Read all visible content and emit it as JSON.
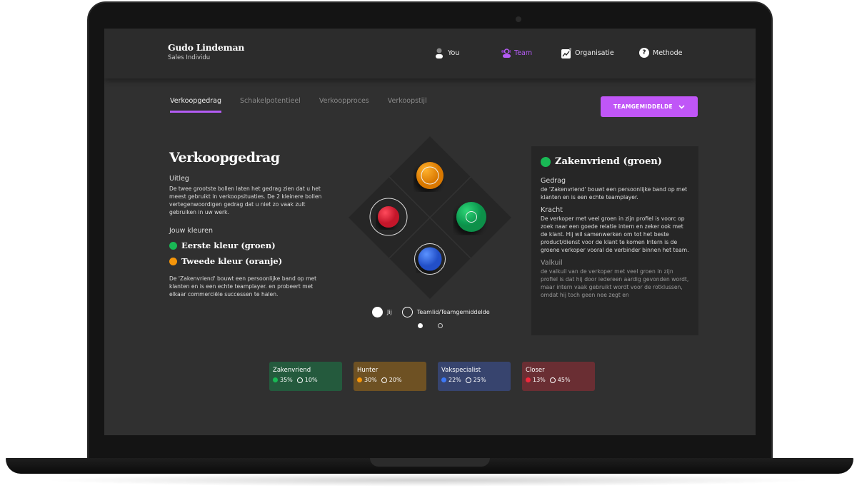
{
  "header": {
    "user_name": "Gudo Lindeman",
    "user_role": "Sales Individu",
    "nav": [
      {
        "label": "You",
        "icon": "user-icon"
      },
      {
        "label": "Team",
        "icon": "team-icon",
        "active": true
      },
      {
        "label": "Organisatie",
        "icon": "chart-icon"
      },
      {
        "label": "Methode",
        "icon": "question-icon"
      }
    ]
  },
  "tabs": [
    {
      "label": "Verkoopgedrag",
      "active": true
    },
    {
      "label": "Schakelpotentieel"
    },
    {
      "label": "Verkoopproces"
    },
    {
      "label": "Verkoopstijl"
    }
  ],
  "dropdown": {
    "label": "TEAMGEMIDDELDE"
  },
  "accent": "#c056f7",
  "main": {
    "title": "Verkoopgedrag",
    "uitleg_label": "Uitleg",
    "uitleg_text": "De twee grootste bollen laten het gedrag zien dat u het meest gebruikt in verkoopsituaties. De 2 kleinere bollen vertegenwoordigen gedrag dat u niet zo vaak zult gebruiken in uw werk.",
    "colors_label": "Jouw kleuren",
    "first_color": "Eerste kleur (groen)",
    "second_color": "Tweede kleur (oranje)",
    "description": "De 'Zakenvriend' bouwt een persoonlijke band op met klanten en is een echte teamplayer. en probeert met elkaar commerciële successen te halen."
  },
  "legend": {
    "you": "Jij",
    "team": "Teamlid/Teamgemiddelde"
  },
  "pagination": {
    "current": 1,
    "total": 2
  },
  "panel": {
    "title": "Zakenvriend (groen)",
    "gedrag_label": "Gedrag",
    "gedrag_text": "de 'Zakenvriend' bouwt een persoonlijke band op met klanten en is een echte teamplayer.",
    "kracht_label": "Kracht",
    "kracht_text": "De verkoper met veel groen in zijn profiel is voorc op zoek naar een goede relatie intern en zeker ook met de klant. Hij wil samenwerken om tot het beste product/dienst voor de klant te komen Intern is de groene verkoper vooral de verbinder binnen het team.",
    "valkuil_label": "Valkuil",
    "valkuil_text": "de valkuil van de verkoper met veel groen in zijn profiel is dat hij door iedereen aardig gevonden wordt, maar intern vaak gebruikt wordt voor de rotklussen, omdat hij toch geen nee zegt en"
  },
  "cards": [
    {
      "name": "Zakenvriend",
      "you": "35%",
      "team": "10%",
      "color": "#19b955",
      "bg": "#245a3d"
    },
    {
      "name": "Hunter",
      "you": "30%",
      "team": "20%",
      "color": "#f5960a",
      "bg": "#6e5123"
    },
    {
      "name": "Vakspecialist",
      "you": "22%",
      "team": "25%",
      "color": "#3d78f5",
      "bg": "#37446e"
    },
    {
      "name": "Closer",
      "you": "13%",
      "team": "45%",
      "color": "#f0283c",
      "bg": "#6a2e33"
    }
  ]
}
